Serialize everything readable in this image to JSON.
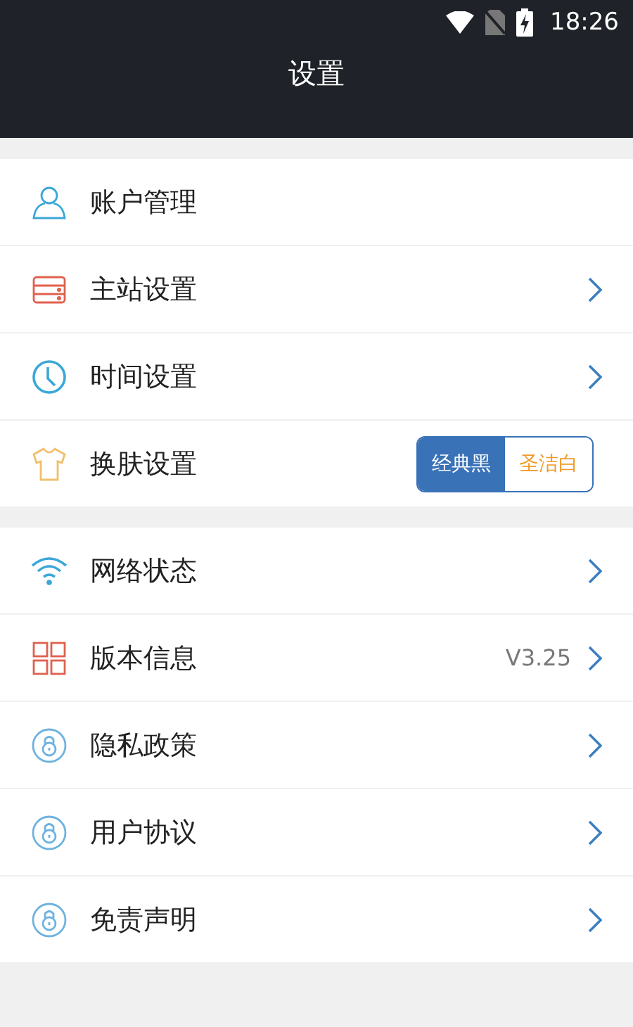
{
  "status_bar": {
    "time": "18:26"
  },
  "header": {
    "title": "设置"
  },
  "sections": [
    {
      "items": [
        {
          "label": "账户管理",
          "arrow": false
        },
        {
          "label": "主站设置",
          "arrow": true
        },
        {
          "label": "时间设置",
          "arrow": true
        },
        {
          "label": "换肤设置",
          "arrow": false,
          "options": [
            {
              "label": "经典黑",
              "selected": true
            },
            {
              "label": "圣洁白",
              "selected": false
            }
          ]
        }
      ]
    },
    {
      "items": [
        {
          "label": "网络状态",
          "arrow": true
        },
        {
          "label": "版本信息",
          "arrow": true,
          "value": "V3.25"
        },
        {
          "label": "隐私政策",
          "arrow": true
        },
        {
          "label": "用户协议",
          "arrow": true
        },
        {
          "label": "免责声明",
          "arrow": true
        }
      ]
    }
  ]
}
